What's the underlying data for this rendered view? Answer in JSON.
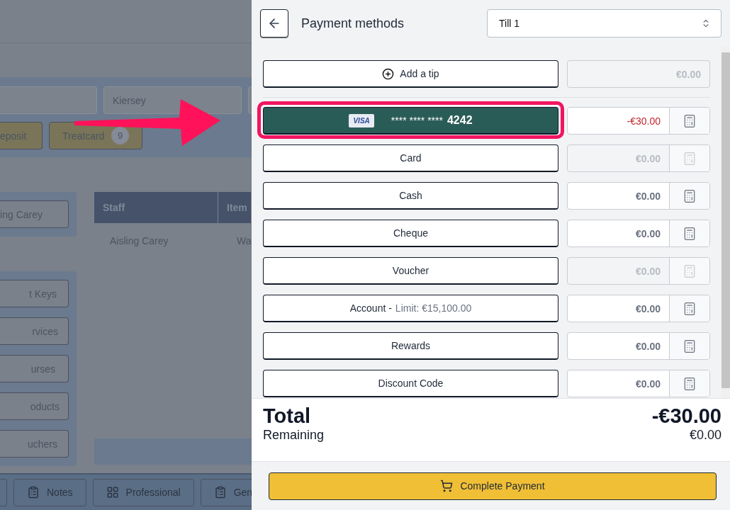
{
  "background": {
    "fields": [
      {
        "value": "Kiersey"
      }
    ],
    "tags": [
      {
        "label": "eposit"
      },
      {
        "label": "Treatcard",
        "count": "9"
      }
    ],
    "staff_button": "ing Carey",
    "table": {
      "columns": [
        "Staff",
        "Item"
      ],
      "rows": [
        [
          "Aisling Carey",
          "Wa"
        ]
      ]
    },
    "menu": [
      "t Keys",
      "rvices",
      "urses",
      "oducts",
      "uchers"
    ],
    "toolbar": [
      {
        "label": "Notes"
      },
      {
        "label": "Professional"
      },
      {
        "label": "Gen"
      }
    ]
  },
  "annotation": {
    "arrow": true
  },
  "panel": {
    "title": "Payment methods",
    "till": "Till 1",
    "tip": {
      "label": "Add a tip",
      "amount": "€0.00"
    },
    "methods": [
      {
        "kind": "saved_card",
        "brand": "VISA",
        "label": "**** **** ****",
        "last4": "4242",
        "amount": "-€30.00",
        "selected": true,
        "highlighted": true,
        "disabled": false
      },
      {
        "kind": "method",
        "label": "Card",
        "amount": "€0.00",
        "selected": false,
        "highlighted": false,
        "disabled": true
      },
      {
        "kind": "method",
        "label": "Cash",
        "amount": "€0.00",
        "selected": false,
        "highlighted": false,
        "disabled": false
      },
      {
        "kind": "method",
        "label": "Cheque",
        "amount": "€0.00",
        "selected": false,
        "highlighted": false,
        "disabled": false
      },
      {
        "kind": "method",
        "label": "Voucher",
        "amount": "€0.00",
        "selected": false,
        "highlighted": false,
        "disabled": true
      },
      {
        "kind": "method",
        "label": "Account -",
        "note": "Limit: €15,100.00",
        "amount": "€0.00",
        "selected": false,
        "highlighted": false,
        "disabled": false
      },
      {
        "kind": "method",
        "label": "Rewards",
        "amount": "€0.00",
        "selected": false,
        "highlighted": false,
        "disabled": false
      },
      {
        "kind": "method",
        "label": "Discount Code",
        "amount": "€0.00",
        "selected": false,
        "highlighted": false,
        "disabled": false
      }
    ],
    "summary": {
      "total_label": "Total",
      "total": "-€30.00",
      "remaining_label": "Remaining",
      "remaining": "€0.00"
    },
    "complete_button": "Complete Payment"
  }
}
